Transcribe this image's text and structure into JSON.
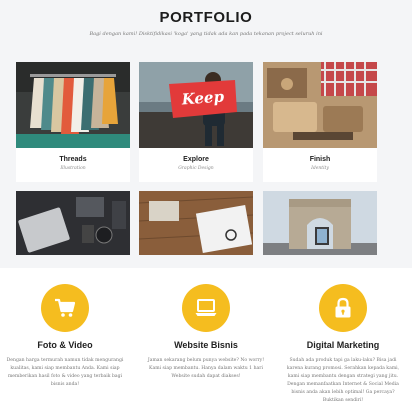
{
  "portfolio": {
    "title": "PORTFOLIO",
    "subtitle": "Bagi dengan kami! Disktifidikasi 'koga' yang tidak ada kan pada tekanan project seluruh ini",
    "items": [
      {
        "title": "Threads",
        "subtitle": "Illustration"
      },
      {
        "title": "Explore",
        "subtitle": "Graphic Design"
      },
      {
        "title": "Finish",
        "subtitle": "Identity"
      },
      {
        "title": "",
        "subtitle": ""
      },
      {
        "title": "",
        "subtitle": ""
      },
      {
        "title": "",
        "subtitle": ""
      }
    ],
    "sign_text": "Keep"
  },
  "services": [
    {
      "title": "Foto & Video",
      "icon": "shopping-cart-icon",
      "description": "Dengan harga termurah namun tidak mengurangi kualitas, kami siap membantu Anda. Kami siap memberikan hasil foto & video yang terbaik bagi bisnis anda!"
    },
    {
      "title": "Website Bisnis",
      "icon": "laptop-icon",
      "description": "Jaman sekarang belum punya website? No worry! Kami siap membantu. Hanya dalam waktu 1 hari Website sudah dapat diakses!"
    },
    {
      "title": "Digital Marketing",
      "icon": "lock-icon",
      "description": "Sudah ada produk tapi ga laku-laku? Bisa jadi karena kurang promosi. Serahkan kepada kami, kami siap membantu dengan strategi yang jitu. Dengan memanfaatkan Internet & Social Media bisnis anda akan lebih optimal! Ga percaya? Buktikan sendiri!"
    }
  ],
  "colors": {
    "accent": "#f5bd1f",
    "section_bg": "#f4f5f7"
  }
}
